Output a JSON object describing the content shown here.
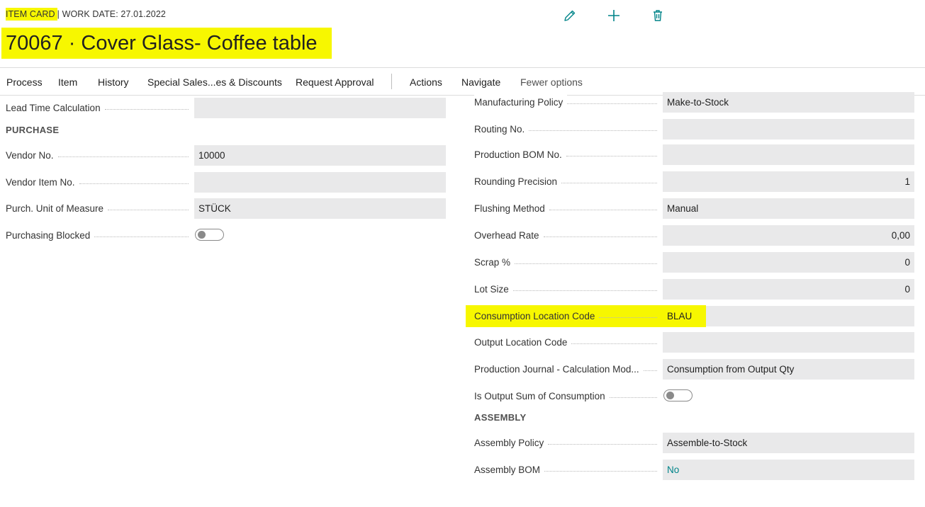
{
  "header": {
    "card_type": "ITEM CARD",
    "work_date": "| WORK DATE: 27.01.2022",
    "title": "70067 · Cover Glass- Coffee table",
    "icons": [
      "pencil-icon",
      "plus-icon",
      "trash-icon"
    ]
  },
  "actions": {
    "process": "Process",
    "item": "Item",
    "history": "History",
    "special_sales": "Special Sales...es & Discounts",
    "request_approval": "Request Approval",
    "actions": "Actions",
    "navigate": "Navigate",
    "fewer_options": "Fewer options"
  },
  "left": {
    "lead_time_label": "Lead Time Calculation",
    "lead_time_value": "",
    "purchase_heading": "PURCHASE",
    "vendor_no_label": "Vendor No.",
    "vendor_no_value": "10000",
    "vendor_item_label": "Vendor Item No.",
    "vendor_item_value": "",
    "purch_uom_label": "Purch. Unit of Measure",
    "purch_uom_value": "STÜCK",
    "purchasing_blocked_label": "Purchasing Blocked"
  },
  "right": {
    "mfg_policy_label": "Manufacturing Policy",
    "mfg_policy_value": "Make-to-Stock",
    "routing_label": "Routing No.",
    "routing_value": "",
    "bom_label": "Production BOM No.",
    "bom_value": "",
    "rounding_label": "Rounding Precision",
    "rounding_value": "1",
    "flushing_label": "Flushing Method",
    "flushing_value": "Manual",
    "overhead_label": "Overhead Rate",
    "overhead_value": "0,00",
    "scrap_label": "Scrap %",
    "scrap_value": "0",
    "lot_label": "Lot Size",
    "lot_value": "0",
    "consumption_loc_label": "Consumption Location Code",
    "consumption_loc_value": "BLAU",
    "output_loc_label": "Output Location Code",
    "output_loc_value": "",
    "prod_journal_label": "Production Journal - Calculation Mod...",
    "prod_journal_value": "Consumption from Output Qty",
    "is_output_sum_label": "Is Output Sum of Consumption",
    "assembly_heading": "ASSEMBLY",
    "assembly_policy_label": "Assembly Policy",
    "assembly_policy_value": "Assemble-to-Stock",
    "assembly_bom_label": "Assembly BOM",
    "assembly_bom_value": "No"
  },
  "colors": {
    "highlight": "#f7f700",
    "field_bg": "#e9e9ea",
    "accent": "#008489"
  }
}
